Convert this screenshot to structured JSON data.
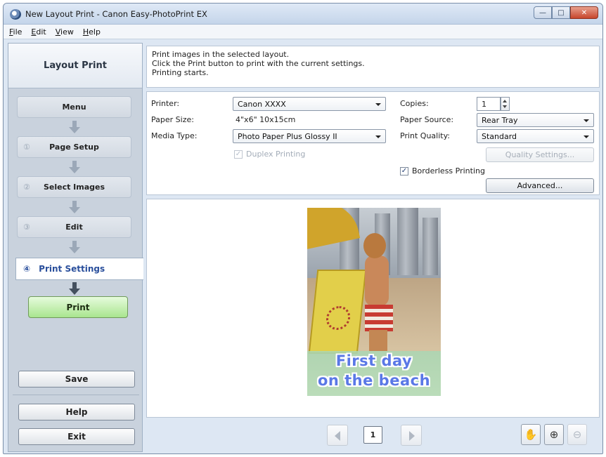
{
  "window": {
    "title": "New Layout Print - Canon Easy-PhotoPrint EX",
    "controls": {
      "minimize": "—",
      "maximize": "□",
      "close": "✕"
    }
  },
  "menu": [
    {
      "u": "F",
      "rest": "ile"
    },
    {
      "u": "E",
      "rest": "dit"
    },
    {
      "u": "V",
      "rest": "iew"
    },
    {
      "u": "H",
      "rest": "elp"
    }
  ],
  "sidebar": {
    "header": "Layout Print",
    "menu_label": "Menu",
    "steps": [
      {
        "num": "①",
        "label": "Page Setup"
      },
      {
        "num": "②",
        "label": "Select Images"
      },
      {
        "num": "③",
        "label": "Edit"
      }
    ],
    "active_step": {
      "num": "④",
      "label": "Print Settings"
    },
    "print_label": "Print",
    "save_label": "Save",
    "help_label": "Help",
    "exit_label": "Exit"
  },
  "info": {
    "lines": [
      "Print images in the selected layout.",
      "Click the Print button to print with the current settings.",
      "Printing starts."
    ]
  },
  "settings": {
    "printer_label": "Printer:",
    "printer_value": "Canon XXXX",
    "paper_size_label": "Paper Size:",
    "paper_size_value": "4\"x6\" 10x15cm",
    "media_type_label": "Media Type:",
    "media_type_value": "Photo Paper Plus Glossy II",
    "duplex_label": "Duplex Printing",
    "duplex_checked": "✓",
    "copies_label": "Copies:",
    "copies_value": "1",
    "paper_source_label": "Paper Source:",
    "paper_source_value": "Rear Tray",
    "print_quality_label": "Print Quality:",
    "print_quality_value": "Standard",
    "quality_settings_label": "Quality Settings...",
    "borderless_label": "Borderless Printing",
    "borderless_checked": "✓",
    "advanced_label": "Advanced..."
  },
  "preview": {
    "caption_line1": "First day",
    "caption_line2": "on the beach"
  },
  "pager": {
    "page": "1"
  },
  "tools": {
    "hand": "✋",
    "zoom_in": "⊕",
    "zoom_out": "⊖"
  }
}
